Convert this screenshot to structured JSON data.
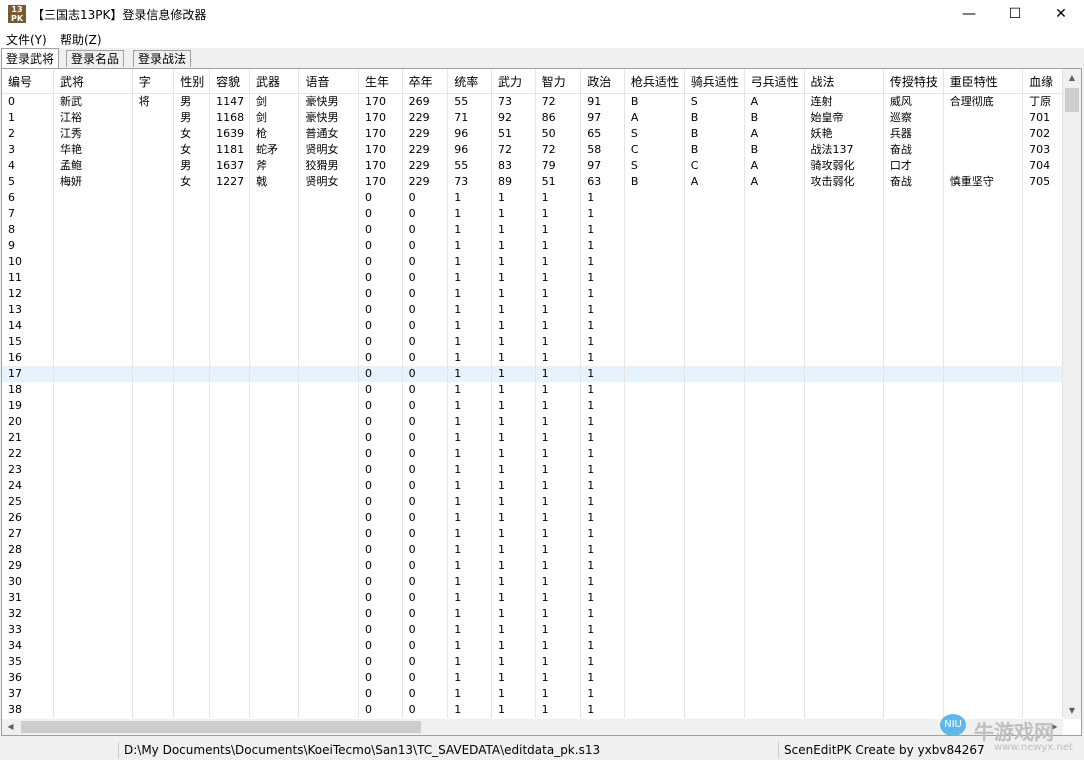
{
  "window": {
    "icon_top": "13",
    "icon_bottom": "PK",
    "title": "【三国志13PK】登录信息修改器",
    "minimize": "—",
    "maximize": "☐",
    "close": "✕"
  },
  "menu": {
    "items": [
      "文件(Y)",
      "帮助(Z)"
    ]
  },
  "tabs": [
    "登录武将",
    "登录名品",
    "登录战法"
  ],
  "table": {
    "columns": [
      "编号",
      "武将",
      "字",
      "性别",
      "容貌",
      "武器",
      "语音",
      "生年",
      "卒年",
      "统率",
      "武力",
      "智力",
      "政治",
      "枪兵适性",
      "骑兵适性",
      "弓兵适性",
      "战法",
      "传授特技",
      "重臣特性",
      "血缘"
    ],
    "selected_row": 17,
    "rows": [
      [
        "0",
        "新武",
        "将",
        "男",
        "1147",
        "剑",
        "豪快男",
        "170",
        "269",
        "55",
        "73",
        "72",
        "91",
        "B",
        "S",
        "A",
        "连射",
        "威风",
        "合理彻底",
        "丁原"
      ],
      [
        "1",
        "江裕",
        "",
        "男",
        "1168",
        "剑",
        "豪快男",
        "170",
        "229",
        "71",
        "92",
        "86",
        "97",
        "A",
        "B",
        "B",
        "始皇帝",
        "巡察",
        "",
        "701"
      ],
      [
        "2",
        "江秀",
        "",
        "女",
        "1639",
        "枪",
        "普通女",
        "170",
        "229",
        "96",
        "51",
        "50",
        "65",
        "S",
        "B",
        "A",
        "妖艳",
        "兵器",
        "",
        "702"
      ],
      [
        "3",
        "华艳",
        "",
        "女",
        "1181",
        "蛇矛",
        "贤明女",
        "170",
        "229",
        "96",
        "72",
        "72",
        "58",
        "C",
        "B",
        "B",
        "战法137",
        "奋战",
        "",
        "703"
      ],
      [
        "4",
        "孟鲍",
        "",
        "男",
        "1637",
        "斧",
        "狡猾男",
        "170",
        "229",
        "55",
        "83",
        "79",
        "97",
        "S",
        "C",
        "A",
        "骑攻弱化",
        "口才",
        "",
        "704"
      ],
      [
        "5",
        "梅妍",
        "",
        "女",
        "1227",
        "戟",
        "贤明女",
        "170",
        "229",
        "73",
        "89",
        "51",
        "63",
        "B",
        "A",
        "A",
        "攻击弱化",
        "奋战",
        "慎重坚守",
        "705"
      ],
      [
        "6",
        "",
        "",
        "",
        "",
        "",
        "",
        "0",
        "0",
        "1",
        "1",
        "1",
        "1",
        "",
        "",
        "",
        "",
        "",
        "",
        ""
      ],
      [
        "7",
        "",
        "",
        "",
        "",
        "",
        "",
        "0",
        "0",
        "1",
        "1",
        "1",
        "1",
        "",
        "",
        "",
        "",
        "",
        "",
        ""
      ],
      [
        "8",
        "",
        "",
        "",
        "",
        "",
        "",
        "0",
        "0",
        "1",
        "1",
        "1",
        "1",
        "",
        "",
        "",
        "",
        "",
        "",
        ""
      ],
      [
        "9",
        "",
        "",
        "",
        "",
        "",
        "",
        "0",
        "0",
        "1",
        "1",
        "1",
        "1",
        "",
        "",
        "",
        "",
        "",
        "",
        ""
      ],
      [
        "10",
        "",
        "",
        "",
        "",
        "",
        "",
        "0",
        "0",
        "1",
        "1",
        "1",
        "1",
        "",
        "",
        "",
        "",
        "",
        "",
        ""
      ],
      [
        "11",
        "",
        "",
        "",
        "",
        "",
        "",
        "0",
        "0",
        "1",
        "1",
        "1",
        "1",
        "",
        "",
        "",
        "",
        "",
        "",
        ""
      ],
      [
        "12",
        "",
        "",
        "",
        "",
        "",
        "",
        "0",
        "0",
        "1",
        "1",
        "1",
        "1",
        "",
        "",
        "",
        "",
        "",
        "",
        ""
      ],
      [
        "13",
        "",
        "",
        "",
        "",
        "",
        "",
        "0",
        "0",
        "1",
        "1",
        "1",
        "1",
        "",
        "",
        "",
        "",
        "",
        "",
        ""
      ],
      [
        "14",
        "",
        "",
        "",
        "",
        "",
        "",
        "0",
        "0",
        "1",
        "1",
        "1",
        "1",
        "",
        "",
        "",
        "",
        "",
        "",
        ""
      ],
      [
        "15",
        "",
        "",
        "",
        "",
        "",
        "",
        "0",
        "0",
        "1",
        "1",
        "1",
        "1",
        "",
        "",
        "",
        "",
        "",
        "",
        ""
      ],
      [
        "16",
        "",
        "",
        "",
        "",
        "",
        "",
        "0",
        "0",
        "1",
        "1",
        "1",
        "1",
        "",
        "",
        "",
        "",
        "",
        "",
        ""
      ],
      [
        "17",
        "",
        "",
        "",
        "",
        "",
        "",
        "0",
        "0",
        "1",
        "1",
        "1",
        "1",
        "",
        "",
        "",
        "",
        "",
        "",
        ""
      ],
      [
        "18",
        "",
        "",
        "",
        "",
        "",
        "",
        "0",
        "0",
        "1",
        "1",
        "1",
        "1",
        "",
        "",
        "",
        "",
        "",
        "",
        ""
      ],
      [
        "19",
        "",
        "",
        "",
        "",
        "",
        "",
        "0",
        "0",
        "1",
        "1",
        "1",
        "1",
        "",
        "",
        "",
        "",
        "",
        "",
        ""
      ],
      [
        "20",
        "",
        "",
        "",
        "",
        "",
        "",
        "0",
        "0",
        "1",
        "1",
        "1",
        "1",
        "",
        "",
        "",
        "",
        "",
        "",
        ""
      ],
      [
        "21",
        "",
        "",
        "",
        "",
        "",
        "",
        "0",
        "0",
        "1",
        "1",
        "1",
        "1",
        "",
        "",
        "",
        "",
        "",
        "",
        ""
      ],
      [
        "22",
        "",
        "",
        "",
        "",
        "",
        "",
        "0",
        "0",
        "1",
        "1",
        "1",
        "1",
        "",
        "",
        "",
        "",
        "",
        "",
        ""
      ],
      [
        "23",
        "",
        "",
        "",
        "",
        "",
        "",
        "0",
        "0",
        "1",
        "1",
        "1",
        "1",
        "",
        "",
        "",
        "",
        "",
        "",
        ""
      ],
      [
        "24",
        "",
        "",
        "",
        "",
        "",
        "",
        "0",
        "0",
        "1",
        "1",
        "1",
        "1",
        "",
        "",
        "",
        "",
        "",
        "",
        ""
      ],
      [
        "25",
        "",
        "",
        "",
        "",
        "",
        "",
        "0",
        "0",
        "1",
        "1",
        "1",
        "1",
        "",
        "",
        "",
        "",
        "",
        "",
        ""
      ],
      [
        "26",
        "",
        "",
        "",
        "",
        "",
        "",
        "0",
        "0",
        "1",
        "1",
        "1",
        "1",
        "",
        "",
        "",
        "",
        "",
        "",
        ""
      ],
      [
        "27",
        "",
        "",
        "",
        "",
        "",
        "",
        "0",
        "0",
        "1",
        "1",
        "1",
        "1",
        "",
        "",
        "",
        "",
        "",
        "",
        ""
      ],
      [
        "28",
        "",
        "",
        "",
        "",
        "",
        "",
        "0",
        "0",
        "1",
        "1",
        "1",
        "1",
        "",
        "",
        "",
        "",
        "",
        "",
        ""
      ],
      [
        "29",
        "",
        "",
        "",
        "",
        "",
        "",
        "0",
        "0",
        "1",
        "1",
        "1",
        "1",
        "",
        "",
        "",
        "",
        "",
        "",
        ""
      ],
      [
        "30",
        "",
        "",
        "",
        "",
        "",
        "",
        "0",
        "0",
        "1",
        "1",
        "1",
        "1",
        "",
        "",
        "",
        "",
        "",
        "",
        ""
      ],
      [
        "31",
        "",
        "",
        "",
        "",
        "",
        "",
        "0",
        "0",
        "1",
        "1",
        "1",
        "1",
        "",
        "",
        "",
        "",
        "",
        "",
        ""
      ],
      [
        "32",
        "",
        "",
        "",
        "",
        "",
        "",
        "0",
        "0",
        "1",
        "1",
        "1",
        "1",
        "",
        "",
        "",
        "",
        "",
        "",
        ""
      ],
      [
        "33",
        "",
        "",
        "",
        "",
        "",
        "",
        "0",
        "0",
        "1",
        "1",
        "1",
        "1",
        "",
        "",
        "",
        "",
        "",
        "",
        ""
      ],
      [
        "34",
        "",
        "",
        "",
        "",
        "",
        "",
        "0",
        "0",
        "1",
        "1",
        "1",
        "1",
        "",
        "",
        "",
        "",
        "",
        "",
        ""
      ],
      [
        "35",
        "",
        "",
        "",
        "",
        "",
        "",
        "0",
        "0",
        "1",
        "1",
        "1",
        "1",
        "",
        "",
        "",
        "",
        "",
        "",
        ""
      ],
      [
        "36",
        "",
        "",
        "",
        "",
        "",
        "",
        "0",
        "0",
        "1",
        "1",
        "1",
        "1",
        "",
        "",
        "",
        "",
        "",
        "",
        ""
      ],
      [
        "37",
        "",
        "",
        "",
        "",
        "",
        "",
        "0",
        "0",
        "1",
        "1",
        "1",
        "1",
        "",
        "",
        "",
        "",
        "",
        "",
        ""
      ],
      [
        "38",
        "",
        "",
        "",
        "",
        "",
        "",
        "0",
        "0",
        "1",
        "1",
        "1",
        "1",
        "",
        "",
        "",
        "",
        "",
        "",
        ""
      ]
    ]
  },
  "status": {
    "path": "D:\\My Documents\\Documents\\KoeiTecmo\\San13\\TC_SAVEDATA\\editdata_pk.s13",
    "credit": "ScenEditPK Create by yxbv84267"
  },
  "watermark": {
    "logo": "NIU",
    "title": "牛游戏网",
    "url": "www.newyx.net"
  }
}
